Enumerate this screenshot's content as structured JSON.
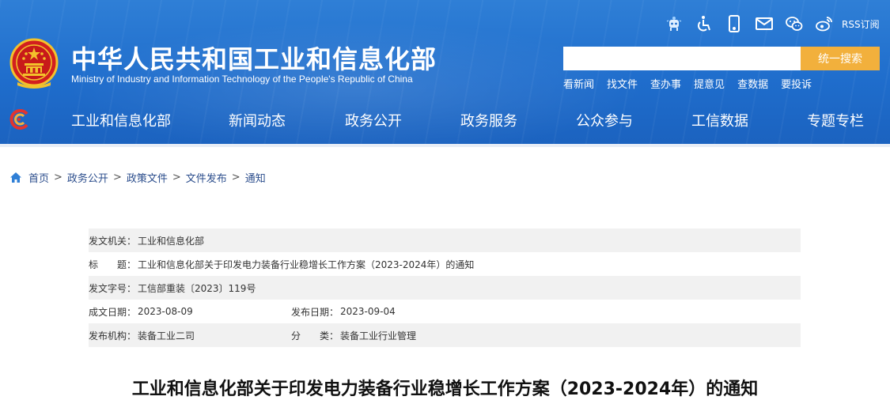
{
  "header": {
    "title": "中华人民共和国工业和信息化部",
    "subtitle": "Ministry of Industry and Information Technology of the People's Republic of China",
    "util_icons": [
      "robot-assistant-icon",
      "accessibility-icon",
      "mobile-icon",
      "mail-icon",
      "wechat-icon",
      "weibo-icon"
    ],
    "rss_label": "RSS订阅",
    "search": {
      "placeholder": "",
      "value": "",
      "button_label": "统一搜索"
    },
    "quick_links": [
      "看新闻",
      "找文件",
      "查办事",
      "提意见",
      "查数据",
      "要投诉"
    ],
    "nav": [
      "工业和信息化部",
      "新闻动态",
      "政务公开",
      "政务服务",
      "公众参与",
      "工信数据",
      "专题专栏"
    ]
  },
  "breadcrumb": {
    "items": [
      "首页",
      "政务公开",
      "政策文件",
      "文件发布",
      "通知"
    ],
    "separator": ">"
  },
  "meta": {
    "issuer_label": "发文机关：",
    "issuer": "工业和信息化部",
    "title_label": "标　　题：",
    "title": "工业和信息化部关于印发电力装备行业稳增长工作方案（2023-2024年）的通知",
    "doc_no_label": "发文字号：",
    "doc_no": "工信部重装〔2023〕119号",
    "written_date_label": "成文日期：",
    "written_date": "2023-08-09",
    "publish_date_label": "发布日期：",
    "publish_date": "2023-09-04",
    "agency_label": "发布机构：",
    "agency": "装备工业二司",
    "category_label": "分　　类：",
    "category": "装备工业行业管理"
  },
  "article": {
    "title": "工业和信息化部关于印发电力装备行业稳增长工作方案（2023-2024年）的通知"
  },
  "colors": {
    "header_blue": "#1f6dcc",
    "search_button": "#f2b03c",
    "breadcrumb_link": "#2b4d8c",
    "meta_gray_row": "#f1f1f1"
  }
}
